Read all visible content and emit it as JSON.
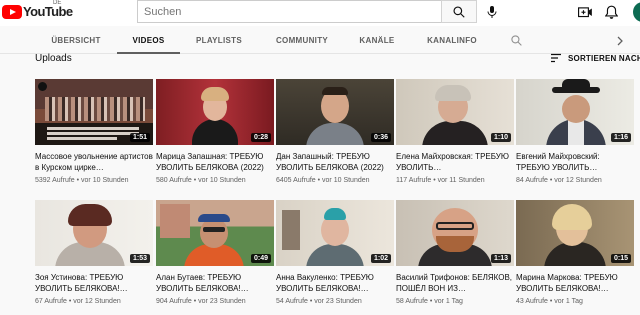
{
  "masthead": {
    "logo_text": "YouTube",
    "region": "DE",
    "search_placeholder": "Suchen"
  },
  "tabs": [
    {
      "label": "ÜBERSICHT"
    },
    {
      "label": "VIDEOS"
    },
    {
      "label": "PLAYLISTS"
    },
    {
      "label": "COMMUNITY"
    },
    {
      "label": "KANÄLE"
    },
    {
      "label": "KANALINFO"
    }
  ],
  "section": {
    "title": "Uploads",
    "sort_label": "SORTIEREN NACH"
  },
  "videos": [
    {
      "title": "Массовое увольнение артистов в Курском цирке…",
      "meta": "5392 Aufrufe • vor 10 Stunden",
      "duration": "1:51"
    },
    {
      "title": "Марица Запашная: ТРЕБУЮ УВОЛИТЬ БЕЛЯКОВА (2022)",
      "meta": "580 Aufrufe • vor 10 Stunden",
      "duration": "0:28"
    },
    {
      "title": "Дан Запашный: ТРЕБУЮ УВОЛИТЬ БЕЛЯКОВА (2022)",
      "meta": "6405 Aufrufe • vor 10 Stunden",
      "duration": "0:36"
    },
    {
      "title": "Елена Майхровская: ТРЕБУЮ УВОЛИТЬ…",
      "meta": "117 Aufrufe • vor 11 Stunden",
      "duration": "1:10"
    },
    {
      "title": "Евгений Майхровский: ТРЕБУЮ УВОЛИТЬ…",
      "meta": "84 Aufrufe • vor 12 Stunden",
      "duration": "1:16"
    },
    {
      "title": "Зоя Устинова: ТРЕБУЮ УВОЛИТЬ БЕЛЯКОВА!…",
      "meta": "67 Aufrufe • vor 12 Stunden",
      "duration": "1:53"
    },
    {
      "title": "Алан Бутаев: ТРЕБУЮ УВОЛИТЬ БЕЛЯКОВА!…",
      "meta": "904 Aufrufe • vor 23 Stunden",
      "duration": "0:49"
    },
    {
      "title": "Анна Вакуленко: ТРЕБУЮ УВОЛИТЬ БЕЛЯКОВА!…",
      "meta": "54 Aufrufe • vor 23 Stunden",
      "duration": "1:02"
    },
    {
      "title": "Василий Трифонов: БЕЛЯКОВ, ПОШЁЛ ВОН ИЗ…",
      "meta": "58 Aufrufe • vor 1 Tag",
      "duration": "1:13"
    },
    {
      "title": "Марина Маркова: ТРЕБУЮ УВОЛИТЬ БЕЛЯКОВА!…",
      "meta": "43 Aufrufe • vor 1 Tag",
      "duration": "0:15"
    }
  ],
  "colors": {
    "brand_red": "#ff0000",
    "avatar_green": "#0c6b52"
  },
  "icons": [
    "search-icon",
    "mic-icon",
    "create-video-icon",
    "bell-icon",
    "sort-icon",
    "chevron-right-icon"
  ]
}
